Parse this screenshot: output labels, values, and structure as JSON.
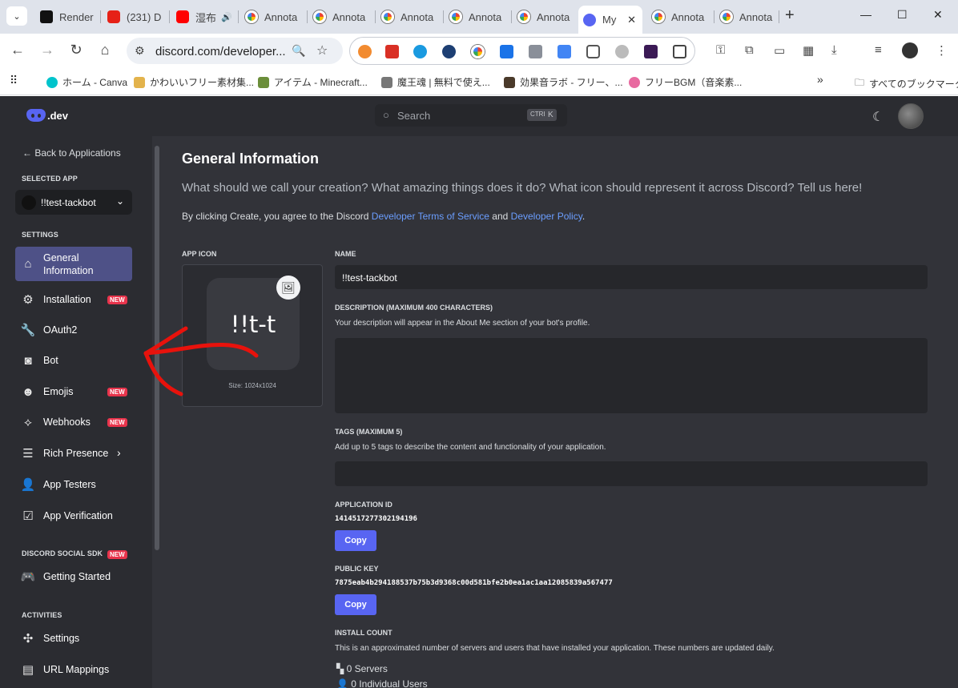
{
  "browser": {
    "tabs": [
      {
        "label": "Render",
        "favicon": "render-icon"
      },
      {
        "label": "(231) D",
        "favicon": "youtube-red-icon"
      },
      {
        "label": "湿布",
        "favicon": "youtube-icon"
      },
      {
        "label": "Annota",
        "favicon": "annotation-icon"
      },
      {
        "label": "Annota",
        "favicon": "annotation-icon"
      },
      {
        "label": "Annota",
        "favicon": "annotation-icon"
      },
      {
        "label": "Annota",
        "favicon": "annotation-icon"
      },
      {
        "label": "Annota",
        "favicon": "annotation-icon"
      },
      {
        "label": "My",
        "favicon": "discord-icon",
        "active": true
      },
      {
        "label": "Annota",
        "favicon": "annotation-icon"
      },
      {
        "label": "Annota",
        "favicon": "annotation-icon"
      }
    ],
    "url": "discord.com/developer...",
    "bookmarks": [
      {
        "label": "ホーム - Canva"
      },
      {
        "label": "かわいいフリー素材集..."
      },
      {
        "label": "アイテム - Minecraft..."
      },
      {
        "label": "魔王魂 | 無料で使え..."
      },
      {
        "label": "効果音ラボ - フリー、..."
      },
      {
        "label": "フリーBGM（音楽素..."
      }
    ],
    "bookmarks_more": "»",
    "all_bookmarks": "すべてのブックマーク"
  },
  "portal": {
    "logo_text": ".dev",
    "search_placeholder": "Search",
    "search_kbd": [
      "CTRL",
      "K"
    ],
    "sidebar": {
      "back": "← Back to Applications",
      "selected_app_heading": "SELECTED APP",
      "app_name": "!!test-tackbot",
      "settings_heading": "SETTINGS",
      "items": [
        {
          "label": "General Information",
          "icon": "home-icon",
          "active": true
        },
        {
          "label": "Installation",
          "icon": "gear-icon",
          "badge": "NEW"
        },
        {
          "label": "OAuth2",
          "icon": "wrench-icon"
        },
        {
          "label": "Bot",
          "icon": "bot-icon"
        },
        {
          "label": "Emojis",
          "icon": "smile-icon",
          "badge": "NEW"
        },
        {
          "label": "Webhooks",
          "icon": "webhook-icon",
          "badge": "NEW"
        },
        {
          "label": "Rich Presence",
          "icon": "document-icon",
          "chevron": true
        },
        {
          "label": "App Testers",
          "icon": "person-add-icon"
        },
        {
          "label": "App Verification",
          "icon": "clipboard-check-icon"
        }
      ],
      "sdk_heading": "DISCORD SOCIAL SDK",
      "sdk_badge": "NEW",
      "sdk_items": [
        {
          "label": "Getting Started",
          "icon": "gamepad-icon"
        }
      ],
      "activities_heading": "ACTIVITIES",
      "activity_items": [
        {
          "label": "Settings",
          "icon": "activity-settings-icon"
        },
        {
          "label": "URL Mappings",
          "icon": "url-mapping-icon"
        }
      ]
    },
    "main": {
      "title": "General Information",
      "lead": "What should we call your creation? What amazing things does it do? What icon should represent it across Discord? Tell us here!",
      "terms_prefix": "By clicking Create, you agree to the Discord ",
      "terms_link": "Developer Terms of Service",
      "terms_and": " and ",
      "policy_link": "Developer Policy",
      "terms_suffix": ".",
      "app_icon_label": "APP ICON",
      "app_icon_text": "!!t-t",
      "app_icon_size": "Size: 1024x1024",
      "name_label": "NAME",
      "name_value": "!!test-tackbot",
      "description_label": "DESCRIPTION (MAXIMUM 400 CHARACTERS)",
      "description_help": "Your description will appear in the About Me section of your bot's profile.",
      "tags_label": "TAGS (MAXIMUM 5)",
      "tags_help": "Add up to 5 tags to describe the content and functionality of your application.",
      "app_id_label": "APPLICATION ID",
      "app_id": "1414517277302194196",
      "copy_label": "Copy",
      "public_key_label": "PUBLIC KEY",
      "public_key": "7875eab4b294188537b75b3d9368c00d581bfe2b0ea1ac1aa12085839a567477",
      "install_count_label": "INSTALL COUNT",
      "install_count_help": "This is an approximated number of servers and users that have installed your application. These numbers are updated daily.",
      "servers": "0 Servers",
      "users": "0 Individual Users"
    }
  },
  "colors": {
    "brand": "#5865f2",
    "badge_red": "#e8344c",
    "active_nav": "#4e5187",
    "annotation_arrow": "#e8120c"
  }
}
